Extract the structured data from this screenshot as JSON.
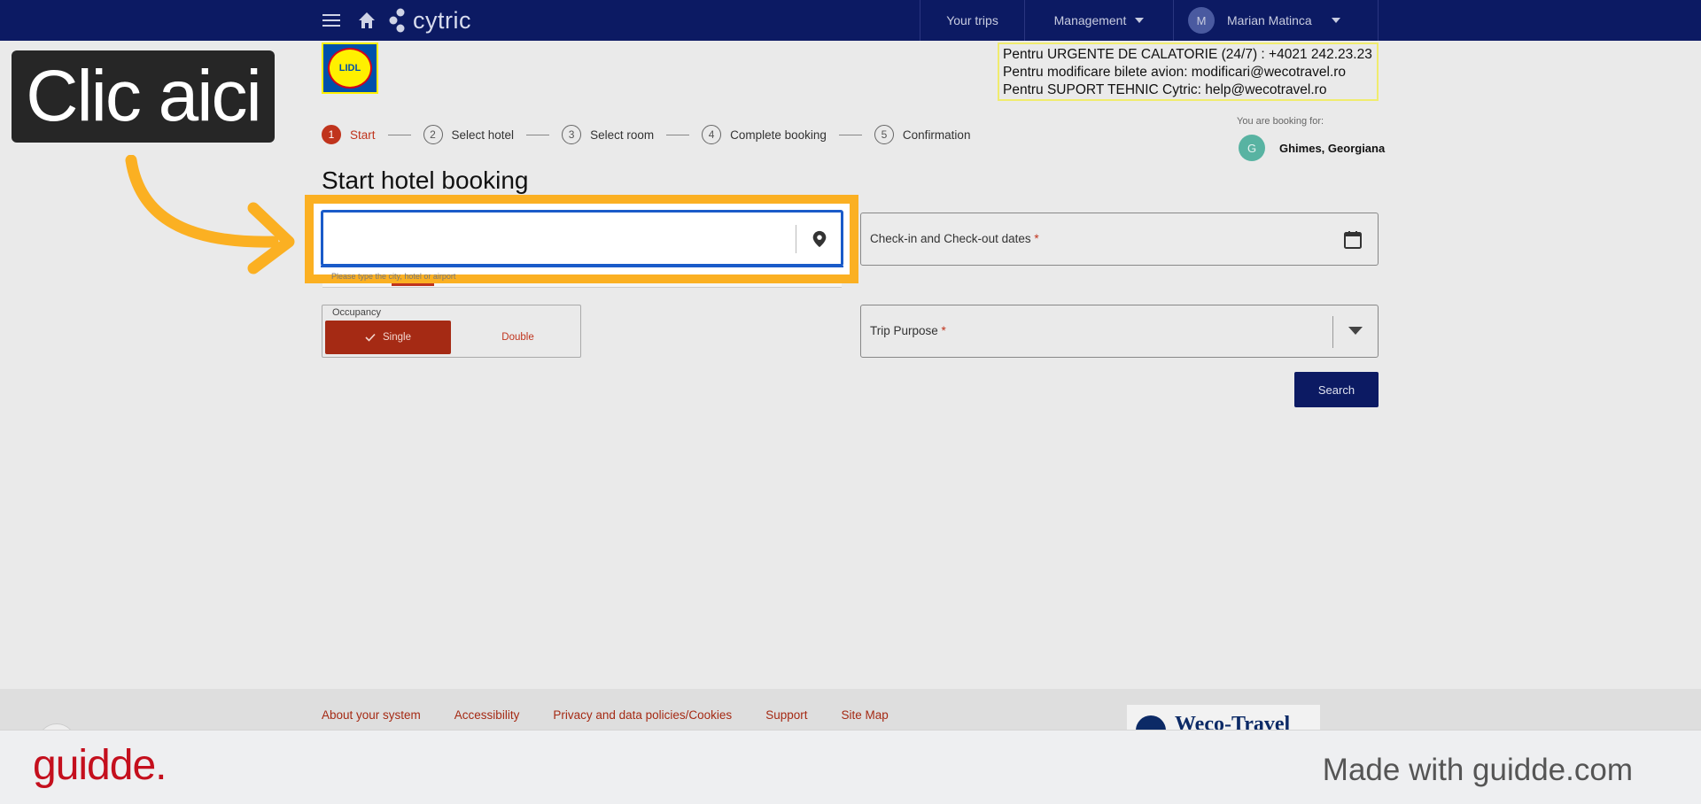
{
  "topbar": {
    "logo_text": "cytric",
    "nav": {
      "your_trips": "Your trips",
      "management": "Management",
      "user_initial": "M",
      "user_name": "Marian Matinca"
    }
  },
  "company_logo_text": "LIDL",
  "contact": {
    "line1": "Pentru URGENTE DE CALATORIE (24/7) : +4021 242.23.23",
    "line2": "Pentru modificare bilete avion:  modificari@wecotravel.ro",
    "line3": "Pentru SUPORT TEHNIC Cytric:  help@wecotravel.ro"
  },
  "stepper": {
    "steps": [
      {
        "num": "1",
        "label": "Start"
      },
      {
        "num": "2",
        "label": "Select hotel"
      },
      {
        "num": "3",
        "label": "Select room"
      },
      {
        "num": "4",
        "label": "Complete booking"
      },
      {
        "num": "5",
        "label": "Confirmation"
      }
    ],
    "active_index": 0
  },
  "booking_for": {
    "label": "You are booking for:",
    "initial": "G",
    "name": "Ghimes, Georgiana"
  },
  "page_title": "Start hotel booking",
  "form": {
    "destination": {
      "value": "",
      "hint": "Please type the city, hotel or airport"
    },
    "dates": {
      "label": "Check-in and Check-out dates",
      "required_mark": "*"
    },
    "occupancy": {
      "label": "Occupancy",
      "single": "Single",
      "double": "Double",
      "selected": "Single"
    },
    "purpose": {
      "label": "Trip Purpose",
      "required_mark": "*"
    },
    "search_label": "Search"
  },
  "footer": {
    "links": [
      "About your system",
      "Accessibility",
      "Privacy and data policies/Cookies",
      "Support",
      "Site Map"
    ],
    "partner_logo_text": "Weco-Travel"
  },
  "annotation": {
    "callout_text": "Clic aici",
    "highlight_color": "#fbb022"
  },
  "banner": {
    "brand": "guidde.",
    "made_with": "Made with guidde.com"
  },
  "colors": {
    "topbar": "#0c1a63",
    "accent_red": "#c0341d",
    "focus_blue": "#1a5bc9",
    "brand_red": "#c40f1d"
  }
}
